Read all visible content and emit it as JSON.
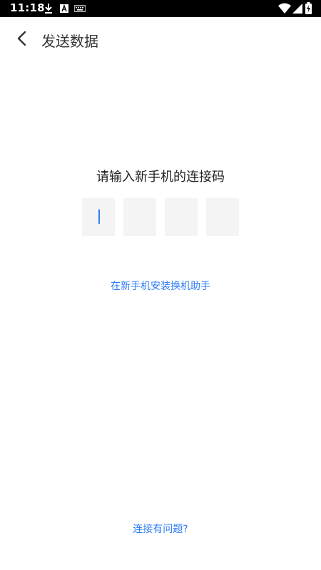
{
  "status_bar": {
    "time": "11:18",
    "left_icons": [
      "download-icon",
      "font-icon",
      "keyboard-icon"
    ],
    "right_icons": [
      "wifi-icon",
      "signal-icon",
      "battery-charging-icon"
    ]
  },
  "header": {
    "back_icon": "chevron-left-icon",
    "title": "发送数据"
  },
  "main": {
    "prompt": "请输入新手机的连接码",
    "code_boxes": [
      "",
      "",
      "",
      ""
    ],
    "focused_box_index": 0,
    "install_link": "在新手机安装换机助手"
  },
  "footer": {
    "help_link": "连接有问题?"
  },
  "colors": {
    "accent": "#2e7cf6",
    "box_background": "#f4f4f4",
    "status_bar": "#000000"
  }
}
